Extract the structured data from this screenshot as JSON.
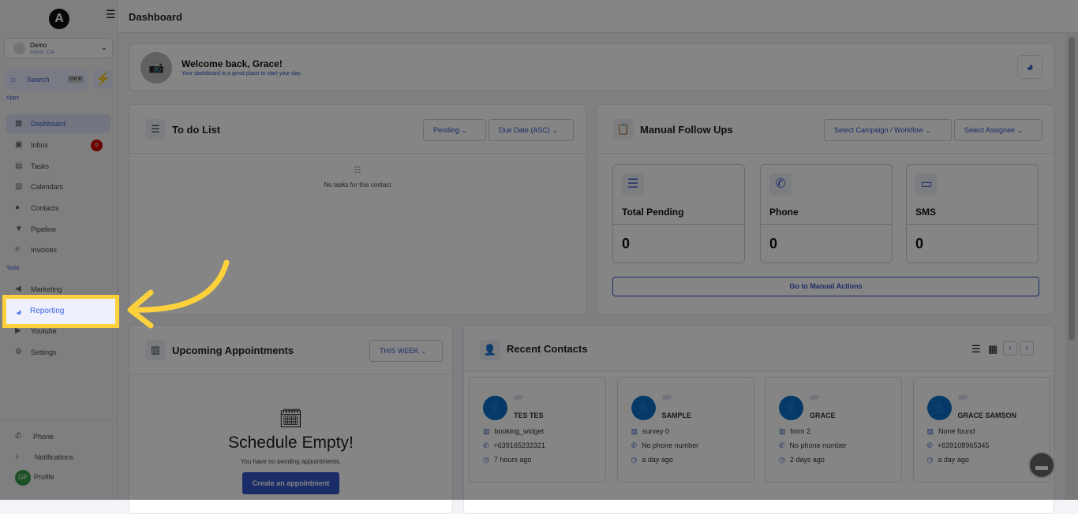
{
  "sidebar": {
    "logo": "A",
    "account": {
      "name": "Demo",
      "location": "Irvine, CA"
    },
    "search": {
      "label": "Search",
      "shortcut": "ctrl K"
    },
    "sections": {
      "apps": "Apps",
      "tools": "Tools"
    },
    "items": [
      {
        "label": "Dashboard",
        "icon": "dashboard-icon"
      },
      {
        "label": "Inbox",
        "icon": "inbox-icon",
        "badge": "0"
      },
      {
        "label": "Tasks",
        "icon": "tasks-icon"
      },
      {
        "label": "Calendars",
        "icon": "calendar-icon"
      },
      {
        "label": "Contacts",
        "icon": "contacts-icon"
      },
      {
        "label": "Pipeline",
        "icon": "pipeline-icon"
      },
      {
        "label": "Invoices",
        "icon": "invoices-icon"
      },
      {
        "label": "Marketing",
        "icon": "megaphone-icon"
      },
      {
        "label": "Reporting",
        "icon": "pie-chart-icon"
      },
      {
        "label": "Youtube",
        "icon": "youtube-icon"
      },
      {
        "label": "Settings",
        "icon": "gear-icon"
      }
    ],
    "bottom": [
      {
        "label": "Phone"
      },
      {
        "label": "Notifications"
      },
      {
        "label": "Profile",
        "initials": "GP"
      }
    ]
  },
  "header": {
    "title": "Dashboard"
  },
  "welcome": {
    "title": "Welcome back, Grace!",
    "subtitle": "Your dashboard is a great place to start your day."
  },
  "todo": {
    "title": "To do List",
    "filter": "Pending",
    "sort": "Due Date (ASC)",
    "empty": "No tasks for this contact"
  },
  "followups": {
    "title": "Manual Follow Ups",
    "campaign": "Select Campaign / Workflow",
    "assignee": "Select Assignee",
    "stats": [
      {
        "label": "Total Pending",
        "value": "0"
      },
      {
        "label": "Phone",
        "value": "0"
      },
      {
        "label": "SMS",
        "value": "0"
      }
    ],
    "action": "Go to Manual Actions"
  },
  "appointments": {
    "title": "Upcoming Appointments",
    "range": "THIS WEEK",
    "empty_title": "Schedule Empty!",
    "empty_text": "You have no pending appointments.",
    "create": "Create an appointment"
  },
  "recent": {
    "title": "Recent Contacts",
    "contacts": [
      {
        "name": "TES TES",
        "source": "booking_widget",
        "phone": "+639165232321",
        "time": "7 hours ago"
      },
      {
        "name": "SAMPLE",
        "source": "survey 0",
        "phone": "No phone number",
        "time": "a day ago"
      },
      {
        "name": "GRACE",
        "source": "form 2",
        "phone": "No phone number",
        "time": "2 days ago"
      },
      {
        "name": "GRACE SAMSON",
        "source": "None found",
        "phone": "+639108965345",
        "time": "a day ago"
      }
    ]
  },
  "colors": {
    "accent": "#3456c8",
    "highlight": "#fdd13c"
  }
}
